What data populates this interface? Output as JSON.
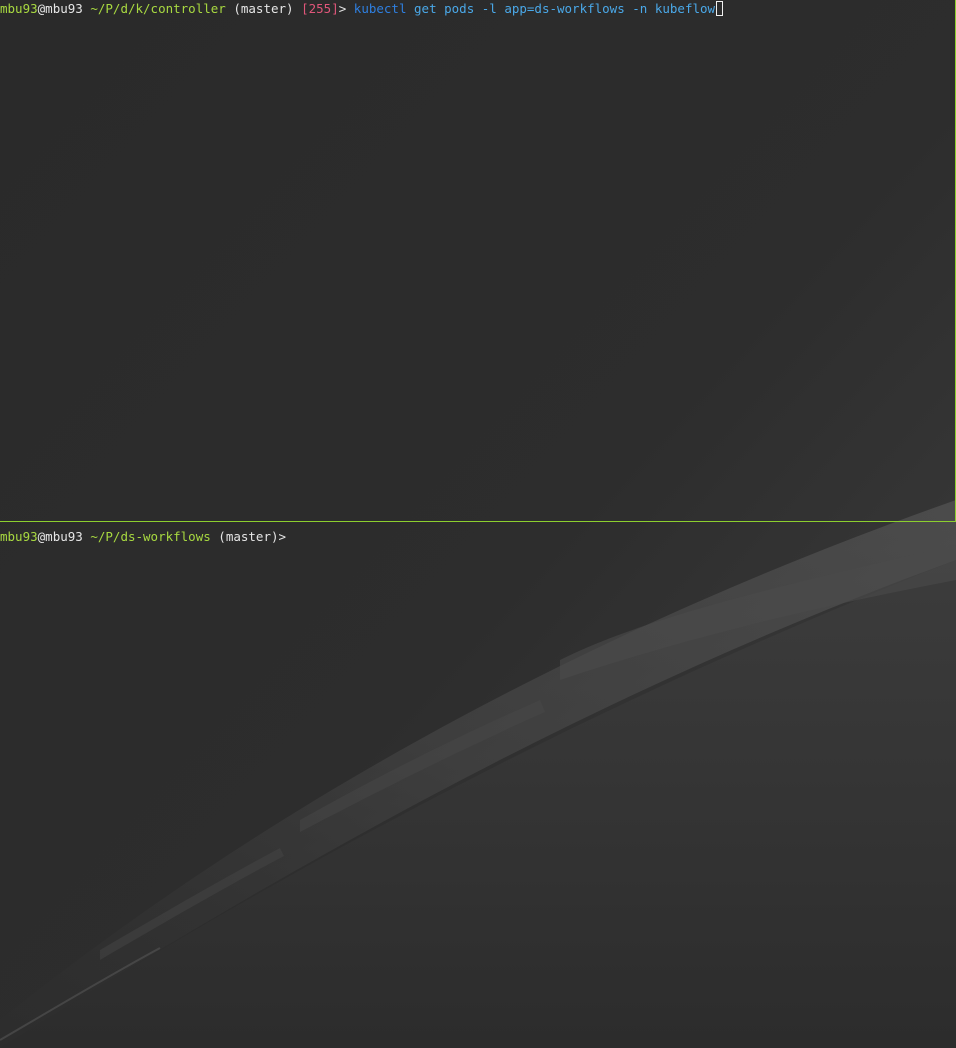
{
  "colors": {
    "user": "#a8d940",
    "cwd": "#a8d940",
    "status_code": "#e0567a",
    "command": "#2e7fe0",
    "argument": "#4aa8e8",
    "pane_border": "#8ccf2e",
    "text": "#e6e6e6"
  },
  "top_pane": {
    "user": "mbu93",
    "at": "@",
    "host": "mbu93",
    "cwd": "~/P/d/k/controller",
    "branch": "(master)",
    "exit_status": "[255]",
    "prompt_char": ">",
    "command": "kubectl",
    "args": "get pods -l app=ds-workflows -n kubeflow"
  },
  "bottom_pane": {
    "user": "mbu93",
    "at": "@",
    "host": "mbu93",
    "cwd": "~/P/ds-workflows",
    "branch": "(master)",
    "prompt_char": ">"
  },
  "wallpaper": {
    "description_icon": "earth-horizon-wallpaper"
  }
}
